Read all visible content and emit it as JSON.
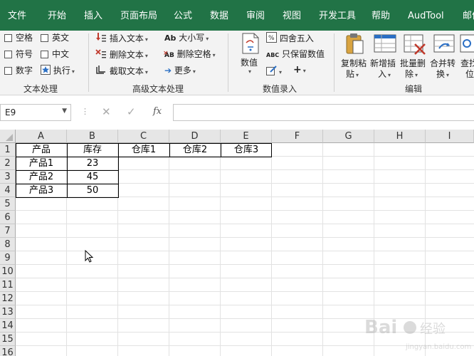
{
  "menu": {
    "tabs": [
      "文件",
      "开始",
      "插入",
      "页面布局",
      "公式",
      "数据",
      "审阅",
      "视图",
      "开发工具",
      "帮助",
      "AudTool",
      "邮件"
    ]
  },
  "ribbon": {
    "text_group": {
      "checkboxes": [
        "空格",
        "英文",
        "符号",
        "中文",
        "数字"
      ],
      "execute": "执行",
      "label": "文本处理"
    },
    "advanced_group": {
      "insert_text": "插入文本",
      "delete_text": "删除文本",
      "cut_text": "截取文本",
      "case": "大小写",
      "delete_space": "删除空格",
      "more": "更多",
      "ab_icon_text": "Ab",
      "ab2_icon_text": "AB",
      "label": "高级文本处理"
    },
    "number_group": {
      "value": "数值",
      "round": "四舍五入",
      "keep_value": "只保留数值",
      "abc_icon_text": "ABC",
      "label": "数值录入"
    },
    "edit_group": {
      "paste_l1": "复制粘",
      "paste_l2": "贴",
      "insert_l1": "新增插",
      "insert_l2": "入",
      "delete_l1": "批量删",
      "delete_l2": "除",
      "merge_l1": "合并转",
      "merge_l2": "换",
      "find_l1": "查找",
      "find_l2": "位",
      "label": "编辑"
    }
  },
  "formula_bar": {
    "name_box": "E9",
    "fx": "fx",
    "formula": ""
  },
  "sheet": {
    "columns": [
      "A",
      "B",
      "C",
      "D",
      "E",
      "F",
      "G",
      "H",
      "I"
    ],
    "rows": [
      "1",
      "2",
      "3",
      "4",
      "5",
      "6",
      "7",
      "8",
      "9",
      "10",
      "11",
      "12",
      "13",
      "14",
      "15",
      "16"
    ],
    "cells": {
      "A1": "产品",
      "B1": "库存",
      "C1": "仓库1",
      "D1": "仓库2",
      "E1": "仓库3",
      "A2": "产品1",
      "B2": "23",
      "A3": "产品2",
      "B3": "45",
      "A4": "产品3",
      "B4": "50"
    }
  },
  "colors": {
    "accent": "#217346",
    "ribbon_bg": "#f3f3f3"
  }
}
